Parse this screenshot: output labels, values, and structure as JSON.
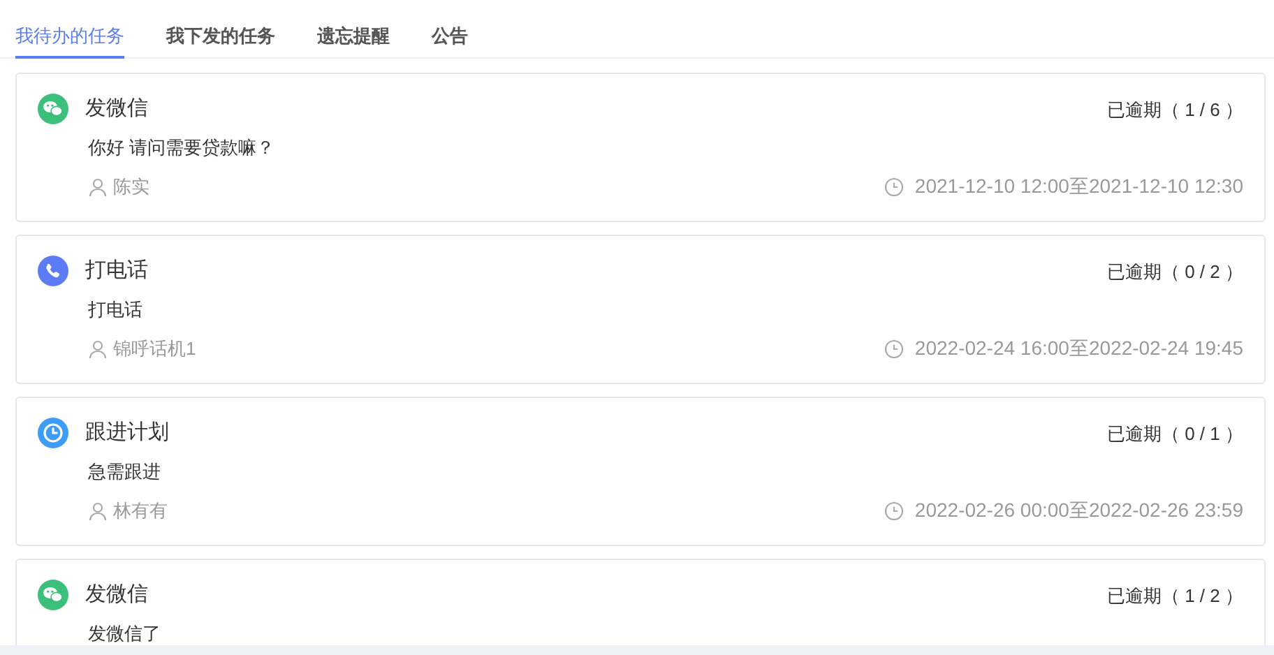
{
  "tabs": [
    {
      "label": "我待办的任务",
      "selected": true
    },
    {
      "label": "我下发的任务",
      "selected": false
    },
    {
      "label": "遗忘提醒",
      "selected": false
    },
    {
      "label": "公告",
      "selected": false
    }
  ],
  "tasks": [
    {
      "kind": "wechat",
      "title": "发微信",
      "status": "已逾期（ 1 / 6 ）",
      "content": "你好 请问需要贷款嘛？",
      "person": "陈实",
      "time": "2021-12-10 12:00至2021-12-10 12:30"
    },
    {
      "kind": "phone",
      "title": "打电话",
      "status": "已逾期（ 0 / 2 ）",
      "content": "打电话",
      "person": "锦呼话机1",
      "time": "2022-02-24 16:00至2022-02-24 19:45"
    },
    {
      "kind": "plan",
      "title": "跟进计划",
      "status": "已逾期（ 0 / 1 ）",
      "content": "急需跟进",
      "person": "林有有",
      "time": "2022-02-26 00:00至2022-02-26 23:59"
    },
    {
      "kind": "wechat",
      "title": "发微信",
      "status": "已逾期（ 1 / 2 ）",
      "content": "发微信了"
    }
  ]
}
